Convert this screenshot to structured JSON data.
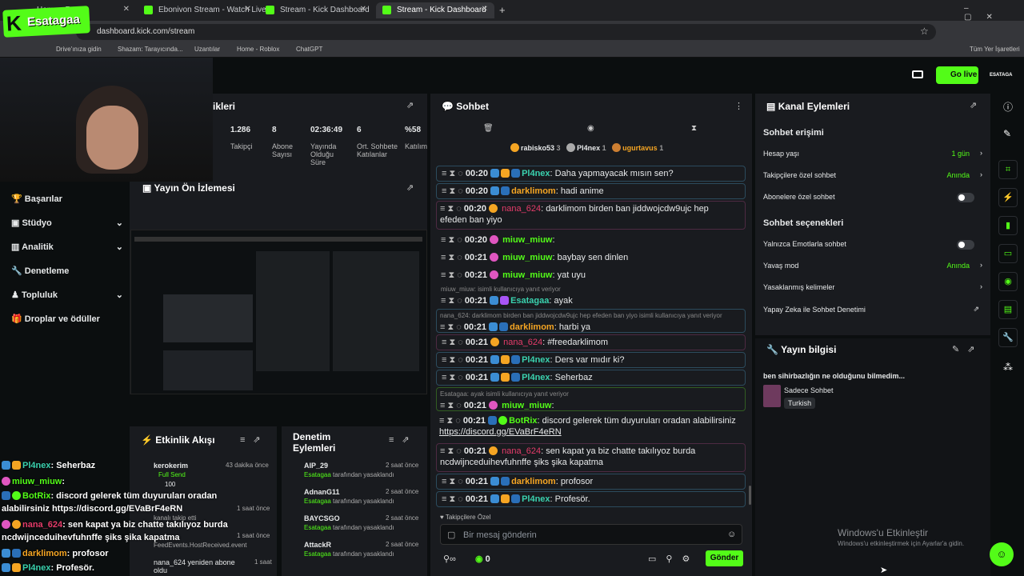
{
  "browser": {
    "tabs": [
      {
        "label": "Home - R"
      },
      {
        "label": "Ebonivon Stream - Watch Live"
      },
      {
        "label": "Stream - Kick Dashboard"
      },
      {
        "label": "Stream - Kick Dashboard"
      }
    ],
    "url": "dashboard.kick.com/stream",
    "bookmarks": [
      "Drive'ınıza gidin",
      "Shazam: Tarayıcında...",
      "Uzantılar",
      "Home - Roblox",
      "ChatGPT",
      "Tüm Yer İşaretleri"
    ]
  },
  "overlay_name": "Esatagaa",
  "topbar": {
    "go_live": "Go live",
    "username": "ESATAGA"
  },
  "sidebar": {
    "items": [
      "Başarılar",
      "Stüdyo",
      "Analitik",
      "Denetleme",
      "Topluluk",
      "Droplar ve ödüller"
    ]
  },
  "stats": {
    "title": "tikleri",
    "values": [
      {
        "v": "1.286",
        "l": "Takipçi"
      },
      {
        "v": "8",
        "l": "Abone Sayısı"
      },
      {
        "v": "02:36:49",
        "l": "Yayında Olduğu Süre"
      },
      {
        "v": "6",
        "l": "Ort. Sohbete Katılanlar"
      },
      {
        "v": "%58",
        "l": "Katılım"
      }
    ]
  },
  "preview": {
    "title": "Yayın Ön İzlemesi"
  },
  "activity": {
    "title": "Etkinlik Akışı",
    "items": [
      {
        "name": "kerokerim",
        "time": "43 dakika önce",
        "sub": "Full Send",
        "n": "100"
      },
      {
        "name": "",
        "time": "1 saat önce",
        "sub": "kanalı takip etti"
      },
      {
        "name": "",
        "time": "1 saat önce",
        "sub": "FeedEvents.HostReceived.event"
      },
      {
        "name": "nana_624 yeniden abone oldu",
        "time": "1 saat"
      }
    ]
  },
  "moderation": {
    "title": "Denetim Eylemleri",
    "items": [
      {
        "name": "AIP_29",
        "time": "2 saat önce",
        "by": "Esatagaa",
        "s": "tarafından yasaklandı"
      },
      {
        "name": "AdnanG11",
        "time": "2 saat önce",
        "by": "Esatagaa",
        "s": "tarafından yasaklandı"
      },
      {
        "name": "BAYCSGO",
        "time": "2 saat önce",
        "by": "Esatagaa",
        "s": "tarafından yasaklandı"
      },
      {
        "name": "AttackR",
        "time": "2 saat önce",
        "by": "Esatagaa",
        "s": "tarafından yasaklandı"
      }
    ]
  },
  "chat": {
    "title": "Sohbet",
    "top": [
      {
        "name": "rabisko53",
        "n": "3"
      },
      {
        "name": "Pl4nex",
        "n": "1"
      },
      {
        "name": "ugurtavus",
        "n": "1"
      }
    ],
    "messages": [
      {
        "t": "00:20",
        "u": "Pl4nex",
        "m": ": Daha yapmayacak mısın sen?"
      },
      {
        "t": "00:20",
        "u": "darklimom",
        "m": ": hadi anime"
      },
      {
        "t": "00:20",
        "u": "nana_624",
        "m": ": darklimom birden ban jiddwojcdw9ujc hep",
        "m2": "efeden ban yiyo"
      },
      {
        "t": "00:20",
        "u": "miuw_miuw",
        "m": ":"
      },
      {
        "t": "00:21",
        "u": "miuw_miuw",
        "m": ": baybay sen dinlen"
      },
      {
        "t": "00:21",
        "u": "miuw_miuw",
        "m": ": yat uyu"
      },
      {
        "t": "00:21",
        "u": "Esatagaa",
        "m": ": ayak",
        "reply": "miuw_miuw:       isimli kullanıcıya yanıt veriyor"
      },
      {
        "t": "00:21",
        "u": "darklimom",
        "m": ": harbi ya",
        "reply": "nana_624: darklimom birden ban jiddwojcdw9ujc hep efeden ban yiyo isimli kullanıcıya yanıt veriyor"
      },
      {
        "t": "00:21",
        "u": "nana_624",
        "m": ": #freedarklimom"
      },
      {
        "t": "00:21",
        "u": "Pl4nex",
        "m": ": Ders var mıdır ki?"
      },
      {
        "t": "00:21",
        "u": "Pl4nex",
        "m": ": Seherbaz"
      },
      {
        "t": "00:21",
        "u": "miuw_miuw",
        "m": ":",
        "reply": "Esatagaa: ayak isimli kullanıcıya yanıt veriyor"
      },
      {
        "t": "00:21",
        "u": "BotRix",
        "m": ": discord gelerek tüm duyuruları oradan alabilirsiniz",
        "m2": "https://discord.gg/EVaBrF4eRN"
      },
      {
        "t": "00:21",
        "u": "nana_624",
        "m": ": sen kapat ya biz chatte takılıyoz burda",
        "m2": "ncdwijnceduihevfuhnffe şiks şika kapatma"
      },
      {
        "t": "00:21",
        "u": "darklimom",
        "m": ": profosor"
      },
      {
        "t": "00:21",
        "u": "Pl4nex",
        "m": ": Profesör."
      }
    ],
    "followers_only": "Takipçilere Özel",
    "placeholder": "Bir mesaj gönderin",
    "send": "Gönder",
    "count": "0"
  },
  "actions": {
    "title": "Kanal Eylemleri",
    "access_title": "Sohbet erişimi",
    "rows": [
      {
        "l": "Hesap yaşı",
        "v": "1 gün"
      },
      {
        "l": "Takipçilere özel sohbet",
        "v": "Anında"
      },
      {
        "l": "Abonelere özel sohbet",
        "v": ""
      }
    ],
    "options_title": "Sohbet seçenekleri",
    "rows2": [
      {
        "l": "Yalnızca Emotlarla sohbet",
        "v": ""
      },
      {
        "l": "Yavaş mod",
        "v": "Anında"
      },
      {
        "l": "Yasaklanmış kelimeler",
        "v": ""
      },
      {
        "l": "Yapay Zeka ile Sohbet Denetimi",
        "v": ""
      }
    ]
  },
  "info": {
    "title": "Yayın bilgisi",
    "stream_title": "ben sihirbazlığın ne olduğunu bilmedim...",
    "category": "Sadece Sohbet",
    "tag": "Turkish"
  },
  "windows": {
    "l1": "Windows'u Etkinleştir",
    "l2": "Windows'u etkinleştirmek için Ayarlar'a gidin."
  },
  "overlay_chat": [
    {
      "u": "Pl4nex",
      "m": ": Seherbaz"
    },
    {
      "u": "miuw_miuw",
      "m": ":"
    },
    {
      "u": "BotRix",
      "m": ": discord gelerek tüm duyuruları oradan"
    },
    {
      "u": "",
      "m": "alabilirsiniz https://discord.gg/EVaBrF4eRN"
    },
    {
      "u": "nana_624",
      "m": ": sen kapat ya biz chatte takılıyoz burda"
    },
    {
      "u": "",
      "m": "ncdwijnceduihevfuhnffe şiks şika kapatma"
    },
    {
      "u": "darklimom",
      "m": ": profosor"
    },
    {
      "u": "Pl4nex",
      "m": ": Profesör."
    }
  ]
}
